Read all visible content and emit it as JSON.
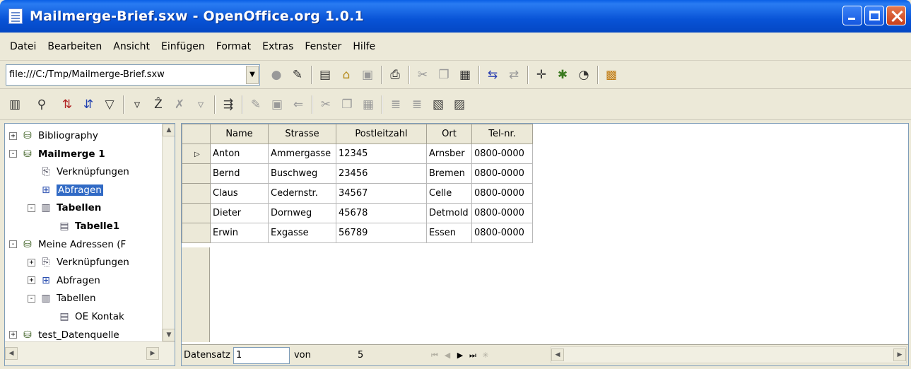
{
  "window": {
    "title": "Mailmerge-Brief.sxw - OpenOffice.org 1.0.1",
    "buttons": [
      "minimize",
      "restore",
      "close"
    ]
  },
  "menu": [
    "Datei",
    "Bearbeiten",
    "Ansicht",
    "Einfügen",
    "Format",
    "Extras",
    "Fenster",
    "Hilfe"
  ],
  "url_bar": {
    "value": "file:///C:/Tmp/Mailmerge-Brief.sxw"
  },
  "toolbar1_icons": [
    "stop-icon",
    "edit-file-icon",
    "new-icon",
    "open-icon",
    "save-icon",
    "print-icon",
    "cut-icon",
    "copy-icon",
    "paste-icon",
    "undo-icon",
    "redo-icon",
    "navigator-icon",
    "stylist-icon",
    "hyperlink-icon",
    "gallery-icon"
  ],
  "toolbar2_icons": [
    "explorer-icon",
    "find-record-icon",
    "sort-ascending-icon",
    "sort-descending-icon",
    "sort-icon",
    "autofilter-icon",
    "standard-filter-icon",
    "remove-filter-icon",
    "apply-filter-icon",
    "data-to-text-icon",
    "edit-data-icon",
    "save-record-icon",
    "undo-record-icon",
    "cut-icon",
    "copy-icon",
    "paste-icon",
    "align-left-icon",
    "align-right-icon",
    "table-icon",
    "query-icon"
  ],
  "tree": {
    "items": [
      {
        "label": "Bibliography",
        "level": 0,
        "expand": "+",
        "icon": "database-icon",
        "bold": false
      },
      {
        "label": "Mailmerge 1",
        "level": 0,
        "expand": "-",
        "icon": "database-icon",
        "bold": true
      },
      {
        "label": "Verknüpfungen",
        "level": 1,
        "expand": "",
        "icon": "links-icon",
        "bold": false
      },
      {
        "label": "Abfragen",
        "level": 1,
        "expand": "",
        "icon": "queries-icon",
        "bold": false,
        "selected": true
      },
      {
        "label": "Tabellen",
        "level": 1,
        "expand": "-",
        "icon": "tables-icon",
        "bold": true
      },
      {
        "label": "Tabelle1",
        "level": 2,
        "expand": "",
        "icon": "table-icon",
        "bold": true
      },
      {
        "label": "Meine Adressen (F",
        "level": 0,
        "expand": "-",
        "icon": "database-icon",
        "bold": false
      },
      {
        "label": "Verknüpfungen",
        "level": 1,
        "expand": "+",
        "icon": "links-icon",
        "bold": false
      },
      {
        "label": "Abfragen",
        "level": 1,
        "expand": "+",
        "icon": "queries-icon",
        "bold": false
      },
      {
        "label": "Tabellen",
        "level": 1,
        "expand": "-",
        "icon": "tables-icon",
        "bold": false
      },
      {
        "label": "OE Kontak",
        "level": 2,
        "expand": "",
        "icon": "table-icon",
        "bold": false
      },
      {
        "label": "test_Datenquelle",
        "level": 0,
        "expand": "+",
        "icon": "database-icon",
        "bold": false
      }
    ]
  },
  "grid": {
    "columns": [
      "Name",
      "Strasse",
      "Postleitzahl",
      "Ort",
      "Tel-nr."
    ],
    "rows": [
      [
        "Anton",
        "Ammergasse",
        "12345",
        "Arnsber",
        "0800-0000"
      ],
      [
        "Bernd",
        "Buschweg",
        "23456",
        "Bremen",
        "0800-0000"
      ],
      [
        "Claus",
        "Cedernstr.",
        "34567",
        "Celle",
        "0800-0000"
      ],
      [
        "Dieter",
        "Dornweg",
        "45678",
        "Detmold",
        "0800-0000"
      ],
      [
        "Erwin",
        "Exgasse",
        "56789",
        "Essen",
        "0800-0000"
      ]
    ],
    "current_row": 0
  },
  "navigation": {
    "record_label": "Datensatz",
    "record_value": "1",
    "of_label": "von",
    "total": "5"
  }
}
